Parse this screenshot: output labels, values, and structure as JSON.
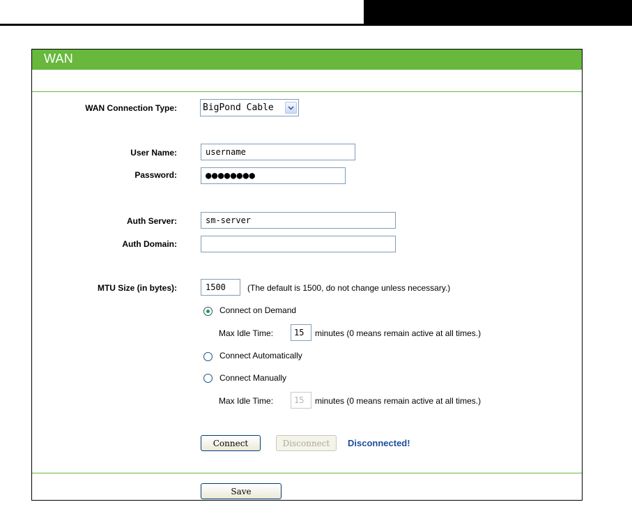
{
  "document": {
    "section_title": "WAN"
  },
  "form": {
    "connection_type": {
      "label": "WAN Connection Type:",
      "selected": "BigPond Cable"
    },
    "user_name": {
      "label": "User Name:",
      "value": "username"
    },
    "password": {
      "label": "Password:",
      "value": "●●●●●●●●"
    },
    "auth_server": {
      "label": "Auth Server:",
      "value": "sm-server"
    },
    "auth_domain": {
      "label": "Auth Domain:",
      "value": ""
    },
    "mtu": {
      "label": "MTU Size (in bytes):",
      "value": "1500",
      "hint": "(The default is 1500, do not change unless necessary.)"
    },
    "connect_modes": [
      {
        "label": "Connect on Demand",
        "selected": true,
        "max_idle_label": "Max Idle Time:",
        "max_idle_value": "15",
        "max_idle_hint": "minutes (0 means remain active at all times.)"
      },
      {
        "label": "Connect Automatically",
        "selected": false
      },
      {
        "label": "Connect Manually",
        "selected": false,
        "max_idle_label": "Max Idle Time:",
        "max_idle_value": "15",
        "max_idle_hint": "minutes (0 means remain active at all times.)"
      }
    ]
  },
  "actions": {
    "connect_label": "Connect",
    "disconnect_label": "Disconnect",
    "status_text": "Disconnected!",
    "save_label": "Save"
  },
  "colors": {
    "header_green": "#67b83c",
    "status_blue": "#1d4d9c"
  }
}
